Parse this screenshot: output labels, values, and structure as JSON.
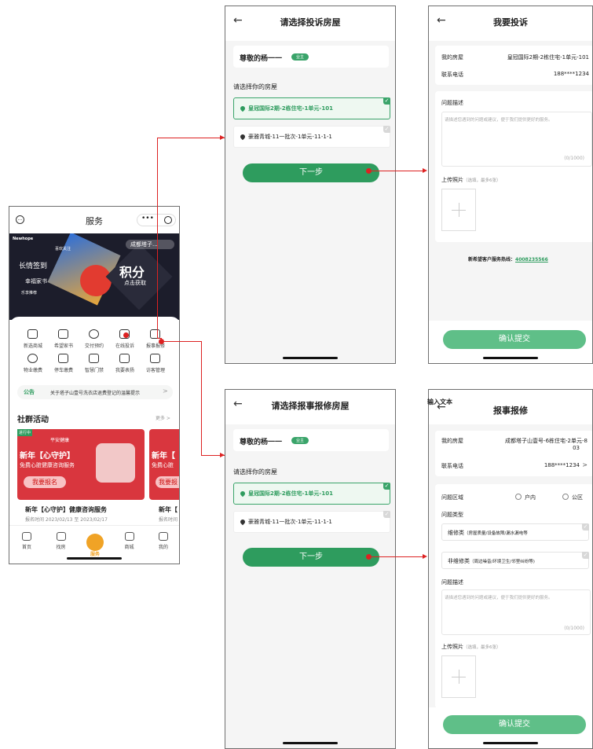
{
  "annotation_label": "输入文本",
  "service": {
    "title": "服务",
    "dots": "•••",
    "banner": {
      "brand": "Newhope",
      "tag1": "喜欢关注",
      "line1": "长情签到",
      "line2": "幸福家书",
      "line3": "乐享推荐",
      "location": "成都塔子...",
      "points_big": "积分",
      "points_small": "点击获取"
    },
    "grid": [
      {
        "label": "新选商城",
        "icon": "shop-icon"
      },
      {
        "label": "希望家书",
        "icon": "mail-icon"
      },
      {
        "label": "交付预约",
        "icon": "clock-icon"
      },
      {
        "label": "在线投诉",
        "icon": "chat-icon"
      },
      {
        "label": "报事报修",
        "icon": "repair-icon"
      },
      {
        "label": "物业缴费",
        "icon": "pay-icon"
      },
      {
        "label": "停车缴费",
        "icon": "parking-icon"
      },
      {
        "label": "智慧门禁",
        "icon": "door-icon"
      },
      {
        "label": "我要表扬",
        "icon": "thumb-icon"
      },
      {
        "label": "访客管理",
        "icon": "visitor-icon"
      }
    ],
    "notice_tag": "公告",
    "notice_text": "关于塔子山壹号洗衣店退费登记的温馨提示",
    "section_title": "社群活动",
    "section_more": "更多 >",
    "activity": {
      "badge": "进行中",
      "partner": "平安健康",
      "big": "新年【心守护】",
      "sub": "免费心脏健康咨询服务",
      "cta": "我要报名",
      "title": "新年【心守护】健康咨询服务",
      "time": "报名时间  2023/02/13 至 2023/02/17",
      "second_title": "新年【",
      "second_sub": "免费心脏",
      "second_cta": "我要报",
      "second_time": "报名时间"
    },
    "tabbar": [
      {
        "label": "首页",
        "icon": "home-icon"
      },
      {
        "label": "找房",
        "icon": "house-icon"
      },
      {
        "label": "服务",
        "icon": "service-icon"
      },
      {
        "label": "商城",
        "icon": "store-icon"
      },
      {
        "label": "我的",
        "icon": "me-icon"
      }
    ]
  },
  "select_complaint": {
    "title": "请选择投诉房屋",
    "greeting": "尊敬的杨一一",
    "badge": "业主",
    "prompt": "请选择你的房屋",
    "house1": "皇冠国际2期-2栋住宅-1单元-101",
    "house2": "豪雅青城-11一批次-1单元-11-1-1",
    "next": "下一步"
  },
  "select_repair": {
    "title": "请选择报事报修房屋",
    "greeting": "尊敬的杨一一",
    "badge": "业主",
    "prompt": "请选择你的房屋",
    "house1": "皇冠国际2期-2栋住宅-1单元-101",
    "house2": "豪雅青城-11一批次-1单元-11-1-1",
    "next": "下一步"
  },
  "complaint": {
    "title": "我要投诉",
    "room_label": "我的房屋",
    "room_value": "皇冠国际2期-2栋住宅-1单元-101",
    "phone_label": "联系电话",
    "phone_value": "188****1234",
    "desc_label": "问题描述",
    "desc_placeholder": "请描述您遇到的问题或建议，便于我们提供更好的服务。",
    "desc_count": "(0/1000)",
    "photo_label": "上传照片",
    "photo_hint": "（选填，最多6张）",
    "hotline_label": "新希望客户服务热线：",
    "hotline": "4008235566",
    "submit": "确认提交"
  },
  "repair": {
    "title": "报事报修",
    "room_label": "我的房屋",
    "room_value": "成都塔子山壹号-6栋住宅-2单元-8",
    "room_value2": "03",
    "phone_label": "联系电话",
    "phone_value": "188****1234",
    "area_label": "问题区域",
    "area_opt1": "户内",
    "area_opt2": "公区",
    "type_label": "问题类型",
    "type1": "维修类",
    "type1_hint": "（房屋质量/设备故障/漏水漏电等",
    "type2": "非维修类",
    "type2_hint": "（周边噪音/环境卫生/邻里纠纷等)",
    "desc_label": "问题描述",
    "desc_placeholder": "请描述您遇到的问题或建议，便于我们提供更好的服务。",
    "desc_count": "(0/1000)",
    "photo_label": "上传照片",
    "photo_hint": "（选填，最多6张）",
    "submit": "确认提交"
  },
  "colors": {
    "accent": "#2e9c5e",
    "arrow": "#dd2222",
    "activity_red": "#d9363e",
    "banner_dark": "#1c1d2b"
  }
}
